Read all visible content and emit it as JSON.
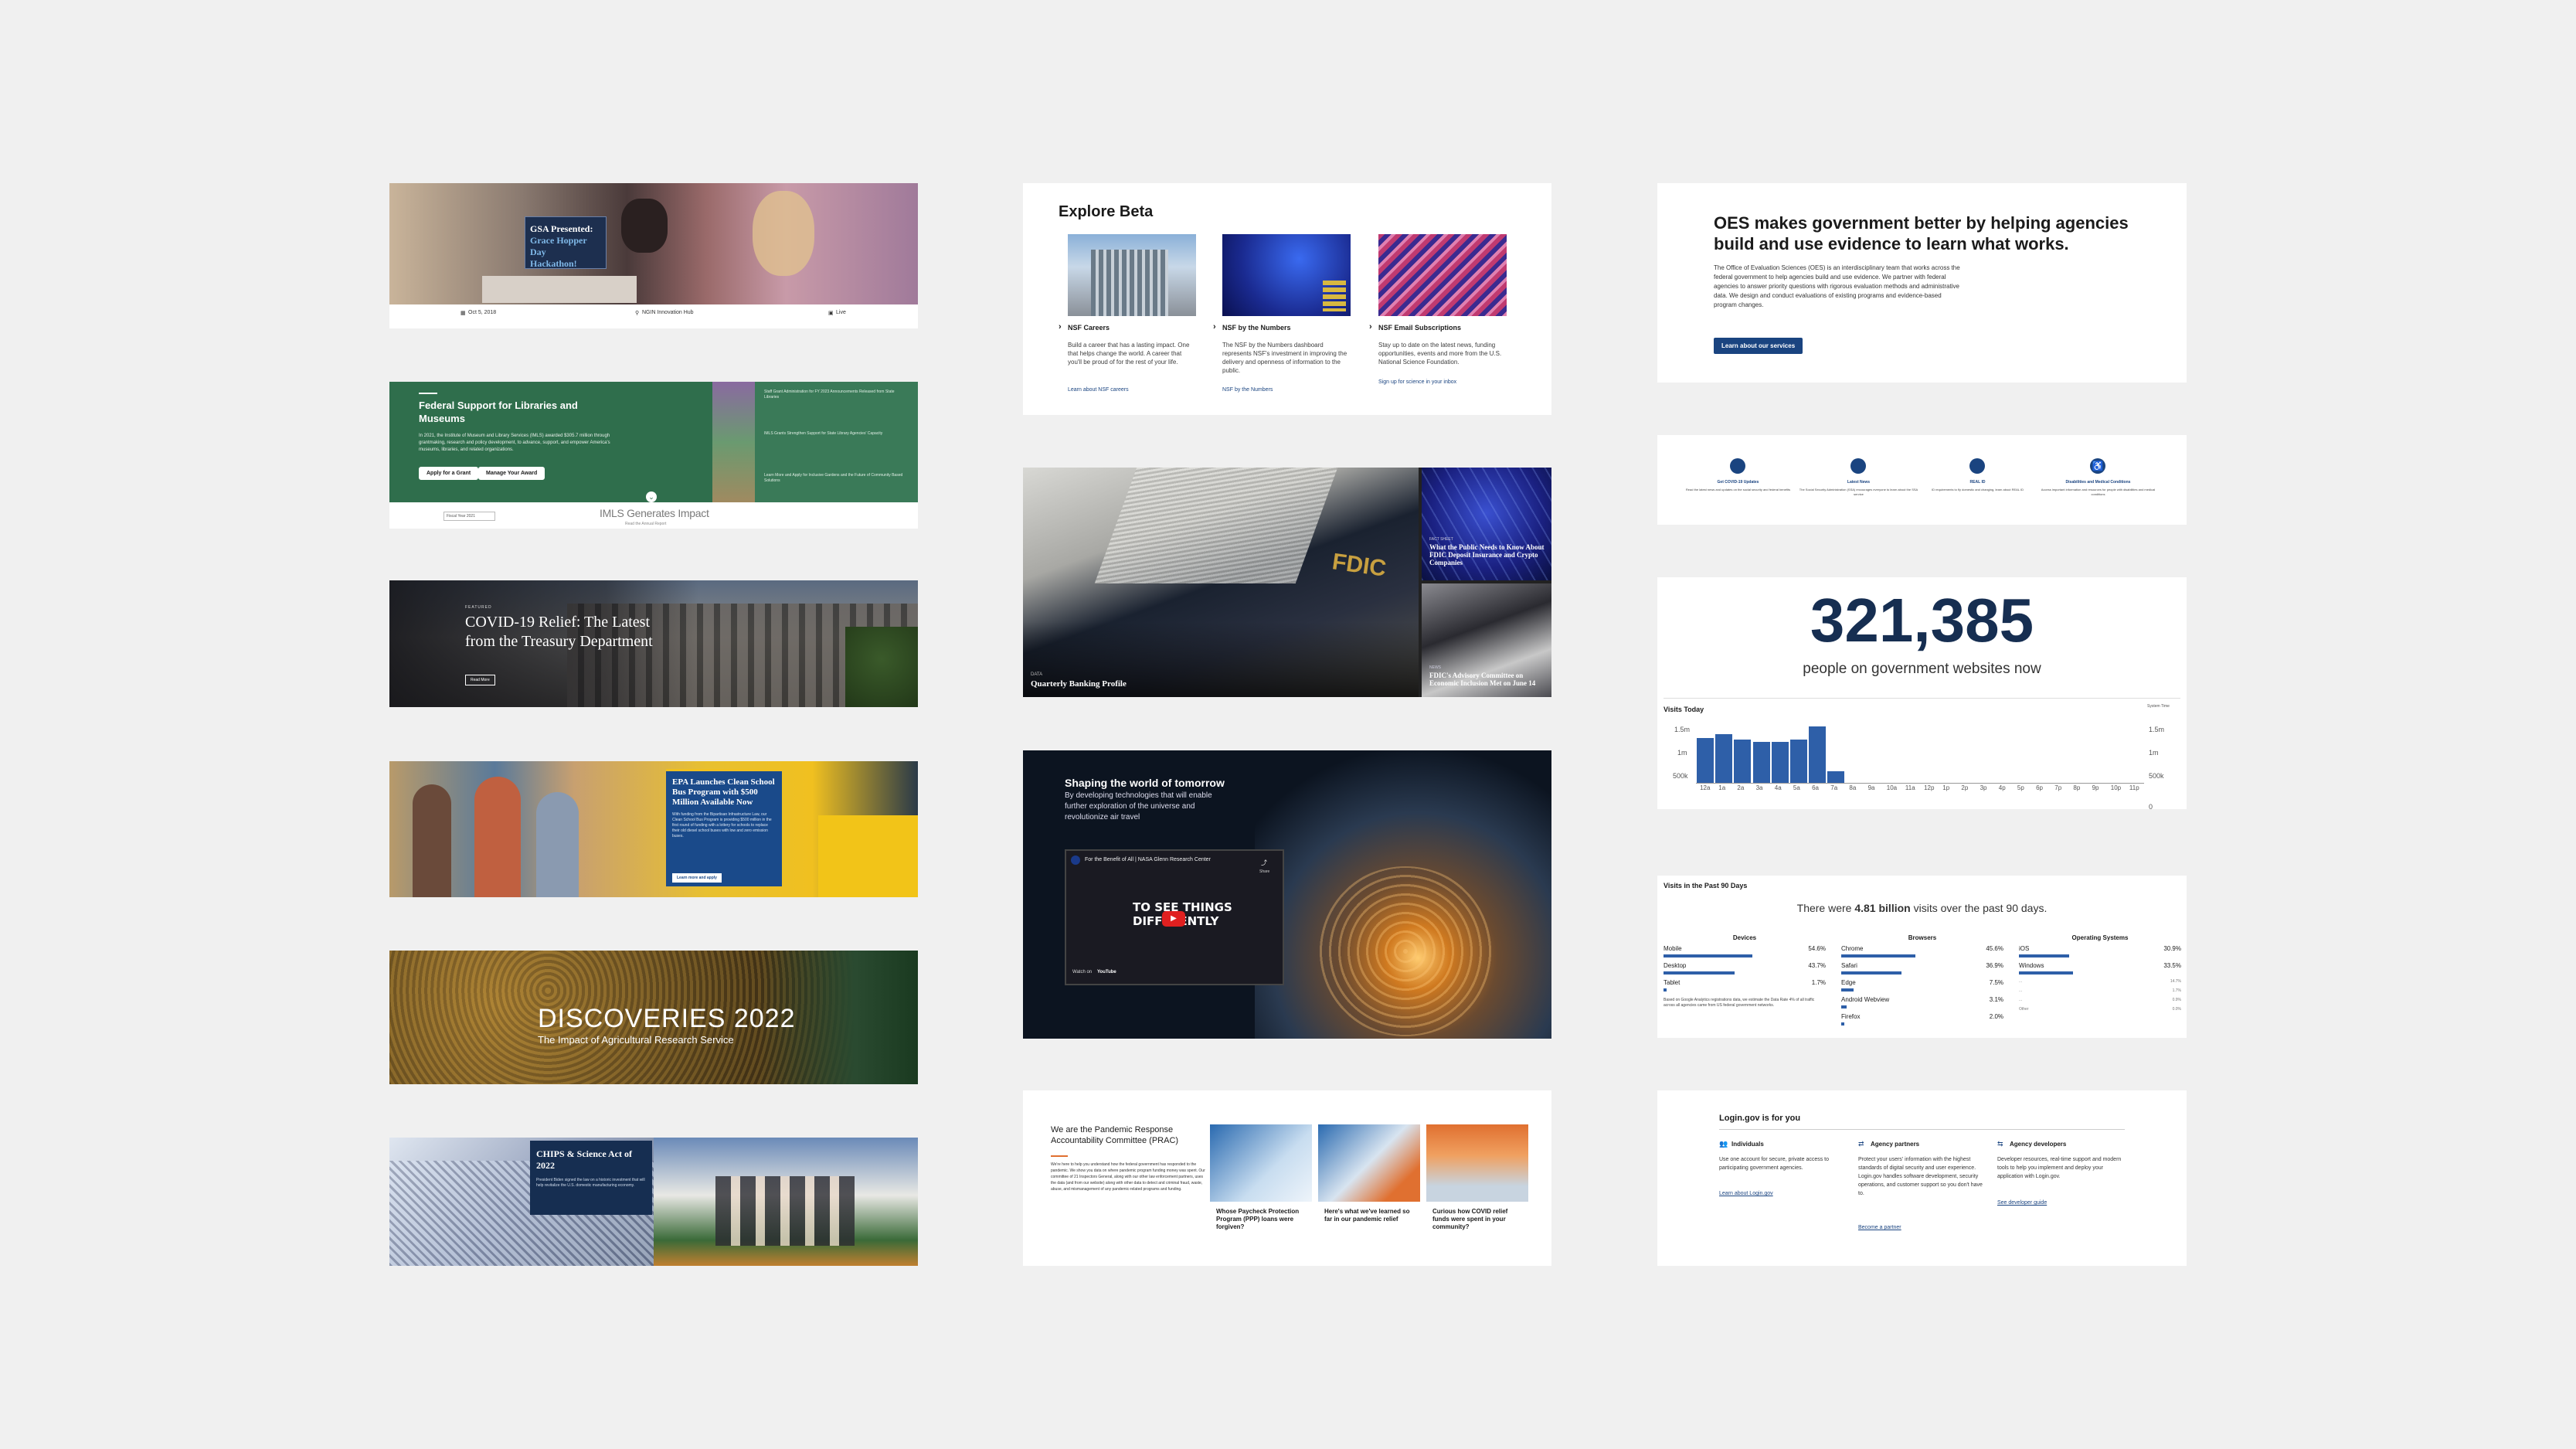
{
  "col1": {
    "gsa": {
      "title_line1": "GSA Presented:",
      "title_line2": "Grace Hopper Day",
      "title_line3": "Hackathon!",
      "meta": [
        "Oct 5, 2018",
        "NGIN Innovation Hub",
        "Live"
      ]
    },
    "imls": {
      "title": "Federal Support for Libraries and Museums",
      "body": "In 2021, the Institute of Museum and Library Services (IMLS) awarded $305.7 million through grantmaking, research and policy development, to advance, support, and empower America's museums, libraries, and related organizations.",
      "btn_apply": "Apply for a Grant",
      "btn_manage": "Manage Your Award",
      "side1": "Staff Grant Administration for FY 2023 Announcements Released from State Libraries",
      "side2": "IMLS Grants Strengthen Support for State Library Agencies' Capacity",
      "side3": "Learn More and Apply for Inclusive Gardens and the Future of Community Based Solutions",
      "footer_label": "Fiscal Year 2021",
      "footer_title": "IMLS Generates Impact",
      "footer_sub": "Read the Annual Report"
    },
    "treasury": {
      "kicker": "FEATURED",
      "title": "COVID-19 Relief: The Latest from the Treasury Department",
      "btn": "Read More"
    },
    "epa": {
      "title": "EPA Launches Clean School Bus Program with $500 Million Available Now",
      "body": "With funding from the Bipartisan Infrastructure Law, our Clean School Bus Program is providing $500 million in the first round of funding with a lottery for schools to replace their old diesel school buses with low and zero emission buses.",
      "btn": "Learn more and apply"
    },
    "ars": {
      "title": "DISCOVERIES 2022",
      "subtitle": "The Impact of Agricultural Research Service"
    },
    "chips": {
      "title": "CHIPS & Science Act of 2022",
      "body": "President Biden signed the law on a historic investment that will help revitalize the U.S. domestic manufacturing economy."
    }
  },
  "col2": {
    "nsf": {
      "title": "Explore Beta",
      "items": [
        {
          "heading": "NSF Careers",
          "body": "Build a career that has a lasting impact. One that helps change the world. A career that you'll be proud of for the rest of your life.",
          "link": "Learn about NSF careers"
        },
        {
          "heading": "NSF by the Numbers",
          "body": "The NSF by the Numbers dashboard represents NSF's investment in improving the delivery and openness of information to the public.",
          "link": "NSF by the Numbers"
        },
        {
          "heading": "NSF Email Subscriptions",
          "body": "Stay up to date on the latest news, funding opportunities, events and more from the U.S. National Science Foundation.",
          "link": "Sign up for science in your inbox"
        }
      ]
    },
    "fdic": {
      "logo": "FDIC",
      "main_kicker": "DATA",
      "main_caption": "Quarterly Banking Profile",
      "tile1_kicker": "FACT SHEET",
      "tile1_caption": "What the Public Needs to Know About FDIC Deposit Insurance and Crypto Companies",
      "tile2_kicker": "NEWS",
      "tile2_caption": "FDIC's Advisory Committee on Economic Inclusion Met on June 14"
    },
    "nasa": {
      "title": "Shaping the world of tomorrow",
      "body": "By developing technologies that will enable further exploration of the universe and revolutionize air travel",
      "video_title": "For the Benefit of All | NASA Glenn Research Center",
      "video_text_line1": "TO SEE THINGS",
      "video_text_line2": "DIFFERENTLY",
      "video_watch": "Watch on",
      "video_brand": "YouTube",
      "video_share": "Share"
    },
    "prac": {
      "title": "We are the Pandemic Response Accountability Committee (PRAC)",
      "body": "We're here to help you understand how the federal government has responded to the pandemic. We show you data on where pandemic program funding money was spent. Our committee of 21 Inspectors General, along with our other law enforcement partners, uses the data (and from our website) along with other data to detect and criminal fraud, waste, abuse, and mismanagement of any pandemic-related programs and funding.",
      "cards": [
        "Whose Paycheck Protection Program (PPP) loans were forgiven?",
        "Here's what we've learned so far in our pandemic relief",
        "Curious how COVID relief funds were spent in your community?"
      ]
    }
  },
  "col3": {
    "oes": {
      "title": "OES makes government better by helping agencies build and use evidence to learn what works.",
      "body": "The Office of Evaluation Sciences (OES) is an interdisciplinary team that works across the federal government to help agencies build and use evidence. We partner with federal agencies to answer priority questions with rigorous evaluation methods and administrative data. We design and conduct evaluations of existing programs and evidence-based program changes.",
      "btn": "Learn about our services"
    },
    "ssa": {
      "items": [
        {
          "heading": "Get COVID-19 Updates",
          "body": "Read the latest news and updates on the social security and federal benefits"
        },
        {
          "heading": "Latest News",
          "body": "The Social Security Administration (SSA) encourages everyone to learn about the SSA service"
        },
        {
          "heading": "REAL ID",
          "body": "ID requirements to fly domestic and changing, learn about REAL ID"
        },
        {
          "heading": "Disabilities and Medical Conditions",
          "body": "Access important information and resources for people with disabilities and medical conditions"
        }
      ]
    },
    "analytics": {
      "number": "321,385",
      "caption": "people on government websites now",
      "chart_label": "Visits Today",
      "chart_legend": "System Time",
      "yticks": [
        "1.5m",
        "1m",
        "500k",
        "0"
      ],
      "visits90_label": "Visits in the Past 90 Days",
      "visits90_pre": "There were",
      "visits90_value": "4.81 billion",
      "visits90_post": "visits over the past 90 days.",
      "devices_title": "Devices",
      "devices": [
        {
          "name": "Mobile",
          "pct": "54.6%"
        },
        {
          "name": "Desktop",
          "pct": "43.7%"
        },
        {
          "name": "Tablet",
          "pct": "1.7%"
        }
      ],
      "browsers_title": "Browsers",
      "browsers": [
        {
          "name": "Chrome",
          "pct": "45.6%"
        },
        {
          "name": "Safari",
          "pct": "36.9%"
        },
        {
          "name": "Edge",
          "pct": "7.5%"
        },
        {
          "name": "Android Webview",
          "pct": "3.1%"
        },
        {
          "name": "Firefox",
          "pct": "2.0%"
        }
      ],
      "os_title": "Operating Systems",
      "os": [
        {
          "name": "iOS",
          "pct": "30.9%"
        },
        {
          "name": "Windows",
          "pct": "33.5%"
        },
        {
          "name": "...",
          "pct": "14.7%"
        },
        {
          "name": "...",
          "pct": "1.7%"
        },
        {
          "name": "...",
          "pct": "0.9%"
        },
        {
          "name": "Other",
          "pct": "0.0%"
        }
      ],
      "note": "Based on Google Analytics registrations data, we estimate the Data Rate 4% of all traffic across all agencies came from US federal government networks."
    },
    "logingov": {
      "title": "Login.gov is for you",
      "items": [
        {
          "heading": "Individuals",
          "body": "Use one account for secure, private access to participating government agencies.",
          "link": "Learn about Login.gov"
        },
        {
          "heading": "Agency partners",
          "body": "Protect your users' information with the highest standards of digital security and user experience. Login.gov handles software development, security operations, and customer support so you don't have to.",
          "link": "Become a partner"
        },
        {
          "heading": "Agency developers",
          "body": "Developer resources, real-time support and modern tools to help you implement and deploy your application with Login.gov.",
          "link": "See developer guide"
        }
      ]
    }
  },
  "chart_data": {
    "type": "bar",
    "title": "Visits Today",
    "categories": [
      "12a",
      "1a",
      "2a",
      "3a",
      "4a",
      "5a",
      "6a",
      "7a",
      "8a",
      "9a",
      "10a",
      "11a",
      "12p",
      "1p",
      "2p",
      "3p",
      "4p",
      "5p",
      "6p",
      "7p",
      "8p",
      "9p",
      "10p",
      "11p"
    ],
    "values": [
      1150000,
      1250000,
      1100000,
      1050000,
      1050000,
      1100000,
      1450000,
      300000,
      0,
      0,
      0,
      0,
      0,
      0,
      0,
      0,
      0,
      0,
      0,
      0,
      0,
      0,
      0,
      0
    ],
    "ylim": [
      0,
      1700000
    ],
    "yticks": [
      "1.5m",
      "1m",
      "500k",
      "0"
    ]
  },
  "colors": {
    "navy": "#1a4480",
    "dark_navy": "#162e51",
    "green": "#2e6b4f",
    "bar": "#2e5fa8",
    "background": "#f0f0f0"
  }
}
